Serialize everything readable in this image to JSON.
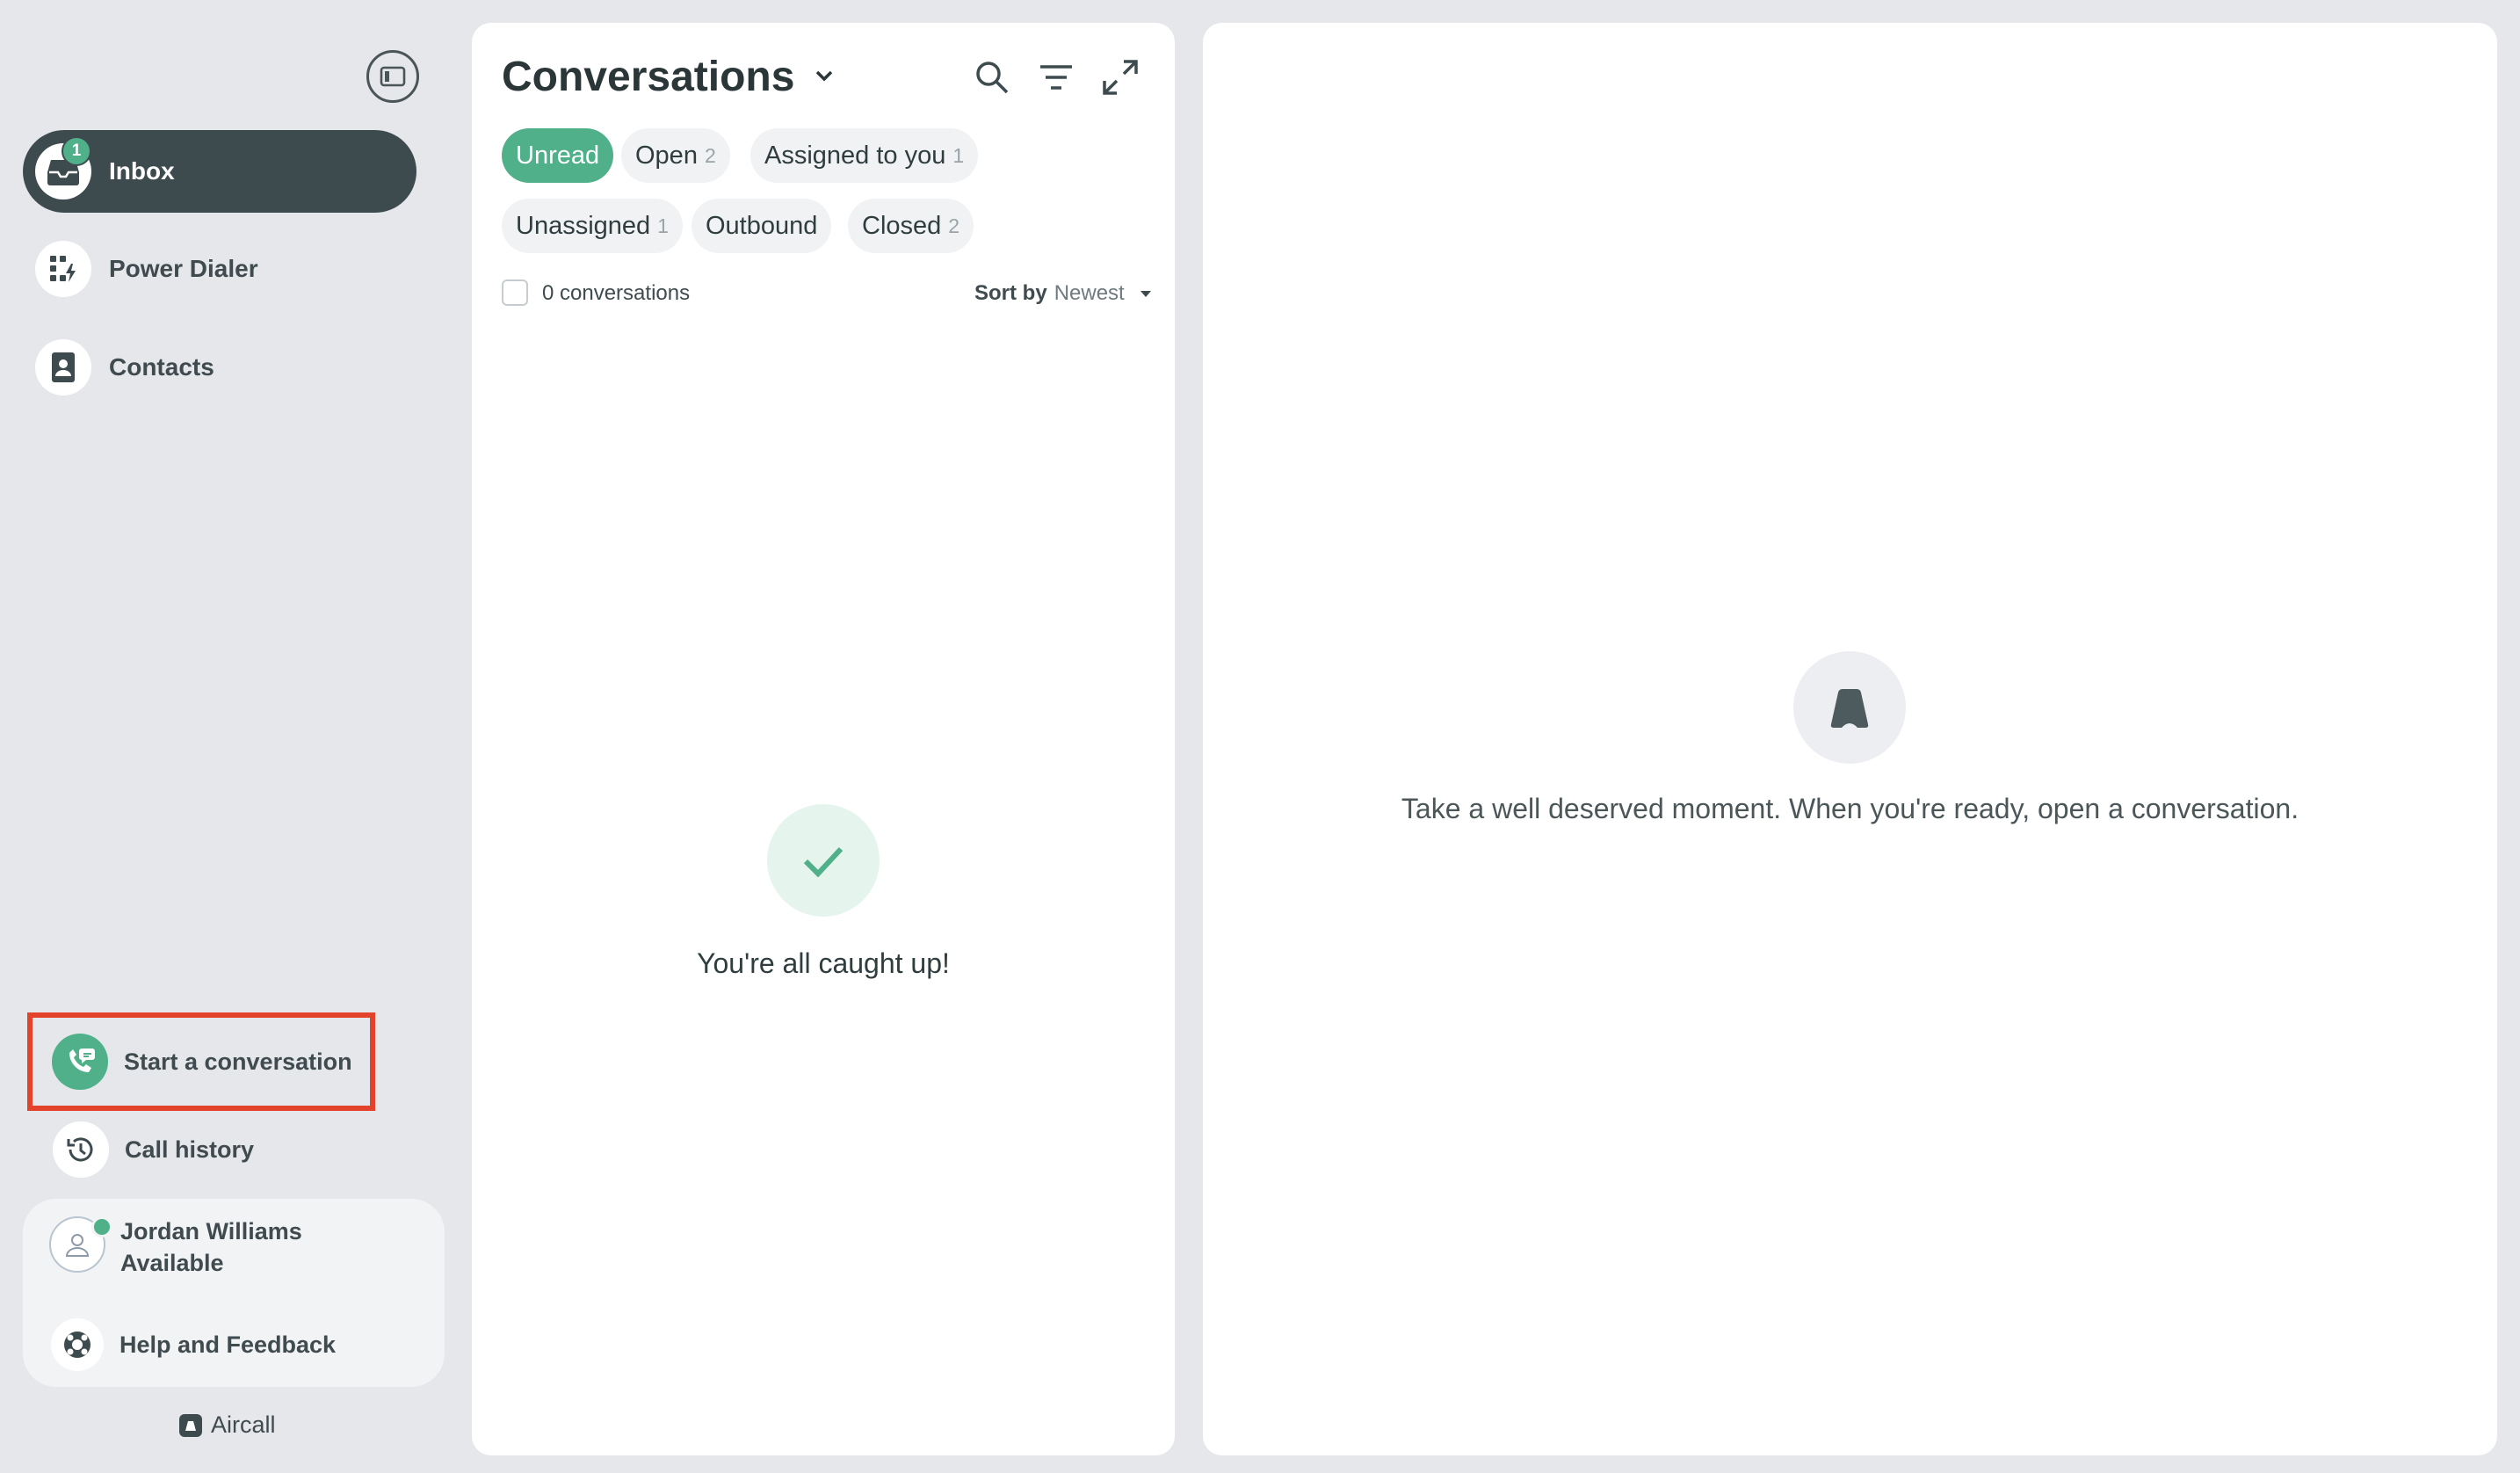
{
  "sidebar": {
    "nav": [
      {
        "label": "Inbox",
        "icon": "inbox-icon",
        "badge": "1",
        "active": true
      },
      {
        "label": "Power Dialer",
        "icon": "power-dialer-icon"
      },
      {
        "label": "Contacts",
        "icon": "contacts-icon"
      }
    ],
    "start_conversation": "Start a conversation",
    "call_history": "Call history",
    "user": {
      "name": "Jordan Williams",
      "status": "Available",
      "status_color": "#4fb08a"
    },
    "help": "Help and Feedback",
    "brand": "Aircall"
  },
  "conversations": {
    "title": "Conversations",
    "filters": [
      {
        "label": "Unread",
        "count": "",
        "active": true
      },
      {
        "label": "Open",
        "count": "2"
      },
      {
        "label": "Assigned to you",
        "count": "1"
      },
      {
        "label": "Unassigned",
        "count": "1"
      },
      {
        "label": "Outbound",
        "count": ""
      },
      {
        "label": "Closed",
        "count": "2"
      }
    ],
    "count_text": "0 conversations",
    "sort_label": "Sort by",
    "sort_value": "Newest",
    "empty_text": "You're all caught up!"
  },
  "detail": {
    "empty_text": "Take a well deserved moment. When you're ready, open a conversation."
  },
  "colors": {
    "accent": "#4fb08a",
    "nav_active": "#3d4b4f",
    "highlight_box": "#e4432b",
    "background": "#e6e7ea"
  }
}
